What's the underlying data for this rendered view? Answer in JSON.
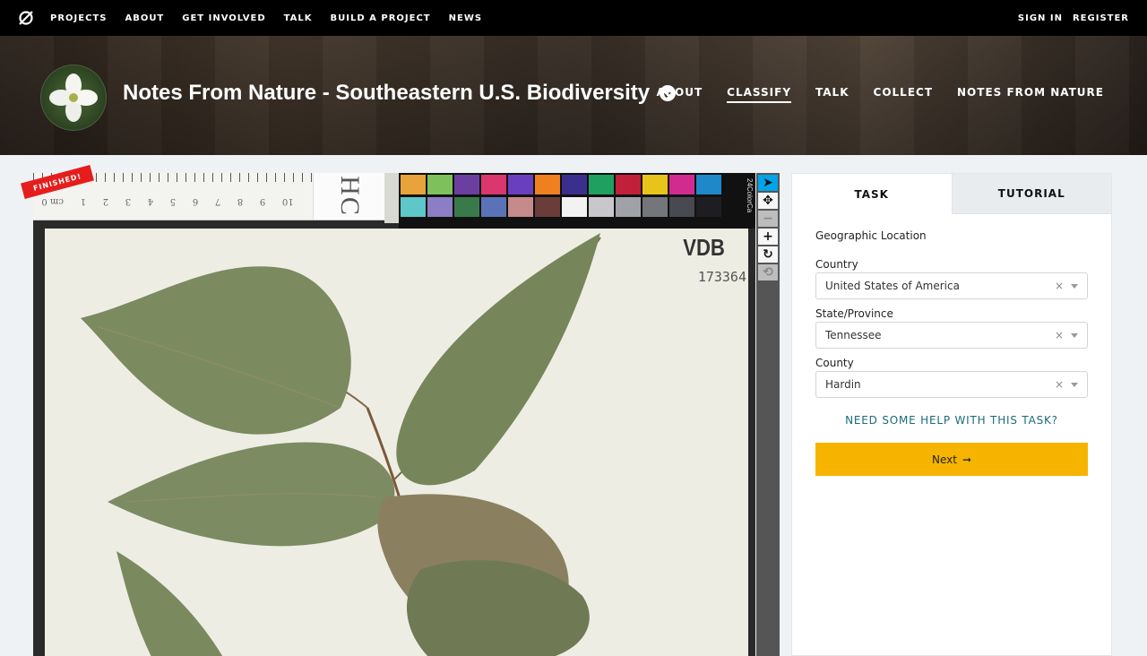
{
  "topnav": {
    "links": [
      "PROJECTS",
      "ABOUT",
      "GET INVOLVED",
      "TALK",
      "BUILD A PROJECT",
      "NEWS"
    ],
    "sign_in": "SIGN IN",
    "register": "REGISTER"
  },
  "project": {
    "title": "Notes From Nature - Southeastern U.S. Biodiversity",
    "nav": [
      "ABOUT",
      "CLASSIFY",
      "TALK",
      "COLLECT",
      "NOTES FROM NATURE"
    ],
    "active_nav": "CLASSIFY"
  },
  "viewer": {
    "badge": "FINISHED!",
    "ruler_numbers": [
      "10",
      "9",
      "8",
      "7",
      "6",
      "5",
      "4",
      "3",
      "2",
      "1",
      "cm 0"
    ],
    "label_text": "HC",
    "herbarium_code": "VDB",
    "accession": "173364",
    "colorcard_text": "24ColorCa",
    "swatches_top": [
      "#e8a33b",
      "#7ec05b",
      "#6b3fa0",
      "#d9376e",
      "#6a3fbf",
      "#f07f1f",
      "#3b2f8e",
      "#20a060",
      "#c0203a",
      "#e8c41b",
      "#d12b8f",
      "#1e88c8"
    ],
    "swatches_bottom": [
      "#5ec7c9",
      "#8c7ec4",
      "#3a7a4a",
      "#5a73b8",
      "#c58a8a",
      "#6a3c3a",
      "#f2f2f2",
      "#c8c8cc",
      "#a0a2a8",
      "#74767c",
      "#474a50",
      "#1e1e22"
    ]
  },
  "toolbar": {
    "tools": [
      {
        "name": "select-tool",
        "glyph": "➤",
        "state": "active"
      },
      {
        "name": "pan-tool",
        "glyph": "✥",
        "state": "normal"
      },
      {
        "name": "zoom-out-tool",
        "glyph": "−",
        "state": "disabled"
      },
      {
        "name": "zoom-in-tool",
        "glyph": "+",
        "state": "normal"
      },
      {
        "name": "rotate-tool",
        "glyph": "↻",
        "state": "normal"
      },
      {
        "name": "reset-tool",
        "glyph": "⟲",
        "state": "disabled"
      }
    ]
  },
  "panel": {
    "tabs": {
      "task": "TASK",
      "tutorial": "TUTORIAL"
    },
    "question": "Geographic Location",
    "fields": [
      {
        "label": "Country",
        "value": "United States of America"
      },
      {
        "label": "State/Province",
        "value": "Tennessee"
      },
      {
        "label": "County",
        "value": "Hardin"
      }
    ],
    "clear_glyph": "×",
    "help": "NEED SOME HELP WITH THIS TASK?",
    "next": "Next",
    "next_arrow": "➞"
  },
  "colors": {
    "accent_yellow": "#f6b400",
    "help_teal": "#1a6b7a",
    "badge_red": "#e61d1d",
    "tool_active": "#00a4e8"
  }
}
